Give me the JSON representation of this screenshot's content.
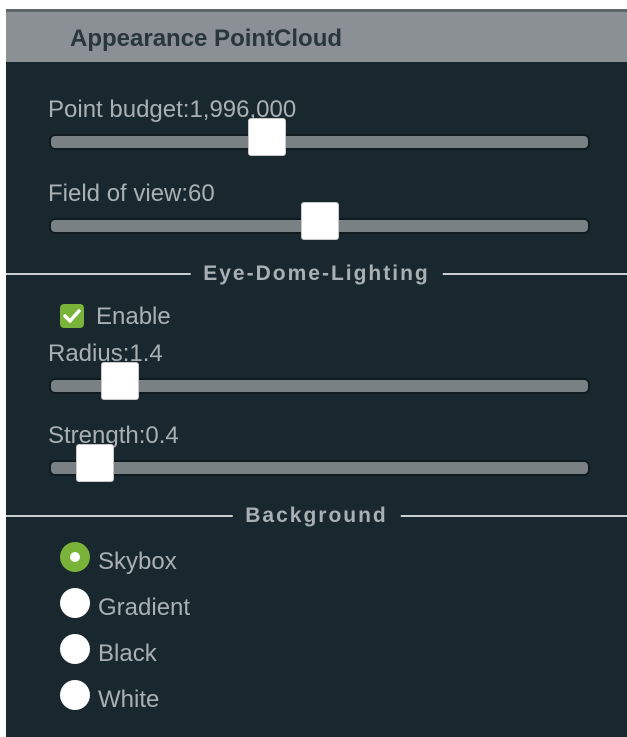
{
  "header": {
    "title": "Appearance PointCloud"
  },
  "point_budget": {
    "label": "Point budget:1,996,000",
    "slider_fraction": 0.395
  },
  "field_of_view": {
    "label": "Field of view:60",
    "slider_fraction": 0.5
  },
  "edl": {
    "section_title": "Eye-Dome-Lighting",
    "enable_label": "Enable",
    "enabled": true,
    "radius": {
      "label": "Radius:1.4",
      "slider_fraction": 0.1
    },
    "strength": {
      "label": "Strength:0.4",
      "slider_fraction": 0.05
    }
  },
  "background": {
    "section_title": "Background",
    "options": [
      {
        "label": "Skybox",
        "checked": true
      },
      {
        "label": "Gradient",
        "checked": false
      },
      {
        "label": "Black",
        "checked": false
      },
      {
        "label": "White",
        "checked": false
      }
    ]
  },
  "colors": {
    "panel_bg": "#19272e",
    "header_bg": "#8a9093",
    "accent_green": "#7ab33a",
    "label_text": "#a9b0b3"
  }
}
